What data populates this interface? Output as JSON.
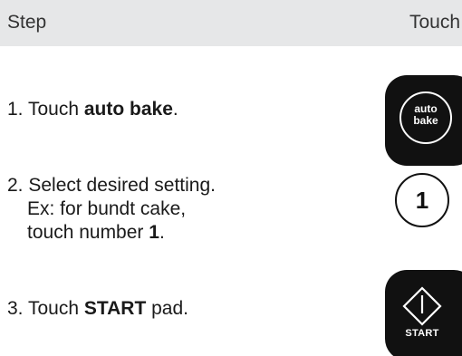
{
  "header": {
    "step_label": "Step",
    "touch_label": "Touch"
  },
  "steps": [
    {
      "number": "1.",
      "prefix": "Touch ",
      "bold": "auto bake",
      "suffix": "."
    },
    {
      "number": "2.",
      "line1": "Select desired setting.",
      "line2": "Ex: for bundt cake,",
      "line3_prefix": "touch number ",
      "line3_bold": "1",
      "line3_suffix": "."
    },
    {
      "number": "3.",
      "prefix": "Touch ",
      "bold": "START",
      "suffix": " pad."
    }
  ],
  "pads": {
    "auto_bake_line1": "auto",
    "auto_bake_line2": "bake",
    "number_label": "1",
    "start_label": "START",
    "start_icon": "diamond-arrow-icon"
  },
  "colors": {
    "header_background": "#e6e7e8",
    "pad_dark": "#111111",
    "pad_text": "#ffffff"
  }
}
